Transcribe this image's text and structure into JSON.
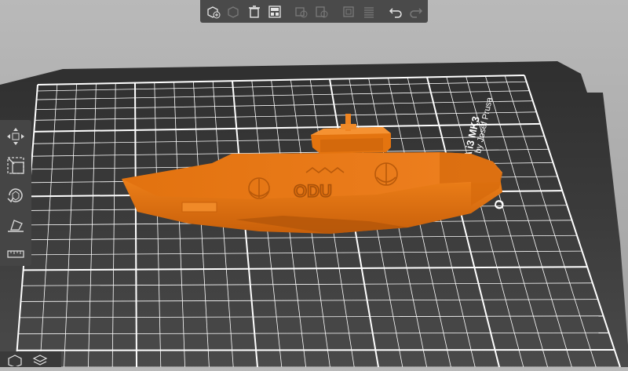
{
  "app": "PrusaSlicer 3D view",
  "toolbar": {
    "items": [
      {
        "name": "add-icon",
        "enabled": true
      },
      {
        "name": "delete-icon",
        "enabled": false
      },
      {
        "name": "delete-all-icon",
        "enabled": true
      },
      {
        "name": "arrange-icon",
        "enabled": true
      },
      {
        "name": "copy-icon",
        "enabled": false
      },
      {
        "name": "paste-icon",
        "enabled": false
      },
      {
        "name": "add-instance-icon",
        "enabled": false
      },
      {
        "name": "split-objects-icon",
        "enabled": false
      },
      {
        "name": "layers-editing-icon",
        "enabled": false
      },
      {
        "name": "undo-icon",
        "enabled": true
      },
      {
        "name": "redo-icon",
        "enabled": false
      }
    ]
  },
  "left_toolbar": {
    "items": [
      "move-icon",
      "scale-icon",
      "rotate-icon",
      "place-on-face-icon",
      "cut-icon"
    ]
  },
  "bed": {
    "printer_line1": "PRUSA i3 MK3",
    "printer_line2": "by Josef Prusa",
    "partial_logo": "O"
  },
  "model": {
    "hull_text": "ODU",
    "color": "#e8740e"
  },
  "colors": {
    "bed_surface": "#3f3f3f",
    "grid": "#ffffff",
    "background": "#b0b0b0",
    "model": "#e8740e",
    "toolbar": "#4a4a4a"
  }
}
